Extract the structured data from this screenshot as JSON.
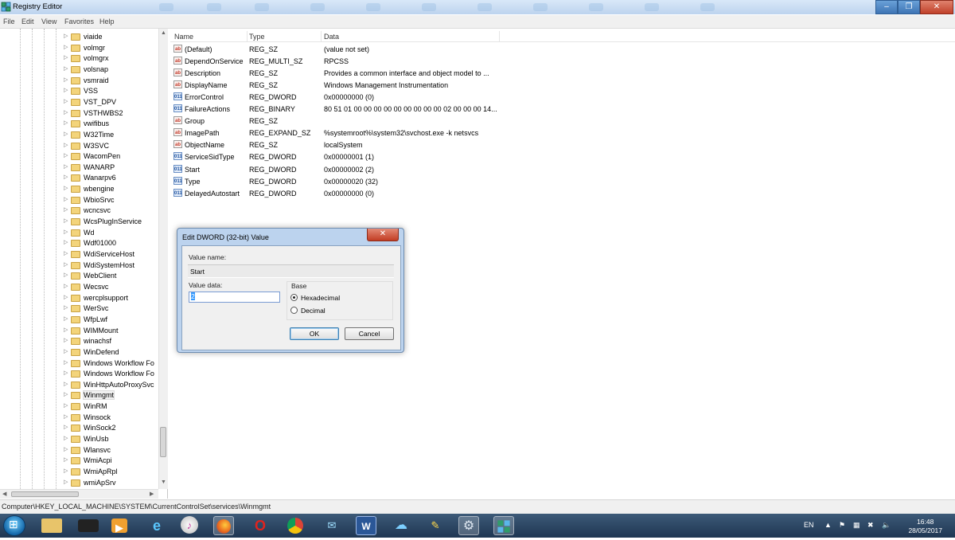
{
  "window": {
    "title": "Registry Editor",
    "minimize": "–",
    "maximize": "❐",
    "close": "✕"
  },
  "menu": [
    "File",
    "Edit",
    "View",
    "Favorites",
    "Help"
  ],
  "tree": {
    "items": [
      "viaide",
      "volmgr",
      "volmgrx",
      "volsnap",
      "vsmraid",
      "VSS",
      "VST_DPV",
      "VSTHWBS2",
      "vwifibus",
      "W32Time",
      "W3SVC",
      "WacomPen",
      "WANARP",
      "Wanarpv6",
      "wbengine",
      "WbioSrvc",
      "wcncsvc",
      "WcsPlugInService",
      "Wd",
      "Wdf01000",
      "WdiServiceHost",
      "WdiSystemHost",
      "WebClient",
      "Wecsvc",
      "wercplsupport",
      "WerSvc",
      "WfpLwf",
      "WIMMount",
      "winachsf",
      "WinDefend",
      "Windows Workflow Fo",
      "Windows Workflow Fo",
      "WinHttpAutoProxySvc",
      "Winmgmt",
      "WinRM",
      "Winsock",
      "WinSock2",
      "WinUsb",
      "Wlansvc",
      "WmiAcpi",
      "WmiApRpl",
      "wmiApSrv"
    ],
    "selected": "Winmgmt",
    "expander": "▷"
  },
  "columns": {
    "name": "Name",
    "type": "Type",
    "data": "Data"
  },
  "values": [
    {
      "icon": "ab",
      "name": "(Default)",
      "type": "REG_SZ",
      "data": "(value not set)"
    },
    {
      "icon": "ab",
      "name": "DependOnService",
      "type": "REG_MULTI_SZ",
      "data": "RPCSS"
    },
    {
      "icon": "ab",
      "name": "Description",
      "type": "REG_SZ",
      "data": "Provides a common interface and object model to ..."
    },
    {
      "icon": "ab",
      "name": "DisplayName",
      "type": "REG_SZ",
      "data": "Windows Management Instrumentation"
    },
    {
      "icon": "011",
      "name": "ErrorControl",
      "type": "REG_DWORD",
      "data": "0x00000000 (0)"
    },
    {
      "icon": "011",
      "name": "FailureActions",
      "type": "REG_BINARY",
      "data": "80 51 01 00 00 00 00 00 00 00 00 00 02 00 00 00 14..."
    },
    {
      "icon": "ab",
      "name": "Group",
      "type": "REG_SZ",
      "data": ""
    },
    {
      "icon": "ab",
      "name": "ImagePath",
      "type": "REG_EXPAND_SZ",
      "data": "%systemroot%\\system32\\svchost.exe -k netsvcs"
    },
    {
      "icon": "ab",
      "name": "ObjectName",
      "type": "REG_SZ",
      "data": "localSystem"
    },
    {
      "icon": "011",
      "name": "ServiceSidType",
      "type": "REG_DWORD",
      "data": "0x00000001 (1)"
    },
    {
      "icon": "011",
      "name": "Start",
      "type": "REG_DWORD",
      "data": "0x00000002 (2)"
    },
    {
      "icon": "011",
      "name": "Type",
      "type": "REG_DWORD",
      "data": "0x00000020 (32)"
    },
    {
      "icon": "011",
      "name": "DelayedAutostart",
      "type": "REG_DWORD",
      "data": "0x00000000 (0)"
    }
  ],
  "dialog": {
    "title": "Edit DWORD (32-bit) Value",
    "close": "✕",
    "value_name_label": "Value name:",
    "value_name": "Start",
    "value_data_label": "Value data:",
    "value_data": "2",
    "base_label": "Base",
    "hex_label": "Hexadecimal",
    "dec_label": "Decimal",
    "base_selected": "Hexadecimal",
    "ok": "OK",
    "cancel": "Cancel"
  },
  "status": {
    "path": "Computer\\HKEY_LOCAL_MACHINE\\SYSTEM\\CurrentControlSet\\services\\Winmgmt"
  },
  "taskbar": {
    "icons": [
      "file-explorer",
      "media-center",
      "media-player",
      "internet-explorer",
      "itunes",
      "firefox",
      "opera",
      "chrome",
      "messenger",
      "word",
      "onedrive",
      "paint",
      "settings",
      "registry-editor"
    ],
    "active": [
      "firefox",
      "settings",
      "registry-editor"
    ],
    "lang": "EN",
    "time": "16:48",
    "date": "28/05/2017"
  },
  "colors": {
    "accent": "#3399ff",
    "titlebar": "#bcd3ee",
    "taskbar": "#2a4766",
    "close": "#c0412a"
  }
}
